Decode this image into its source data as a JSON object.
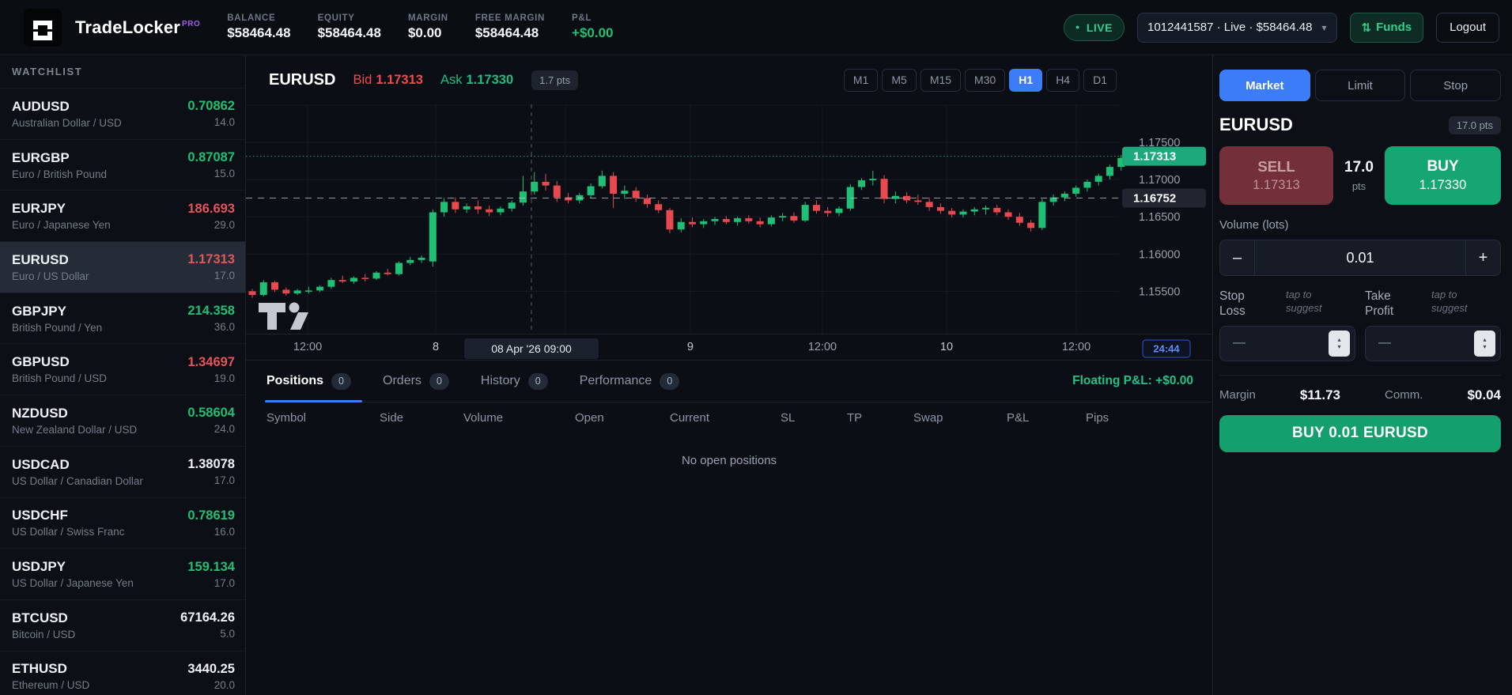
{
  "colors": {
    "up": "#1fbf75",
    "down": "#e8494f",
    "watch_down": "#e4555a",
    "up_badge": "#1ea97c",
    "accent_blue": "#3d7cf7",
    "grid": "#161b24",
    "axis_text": "#99a1ae",
    "major_text": "#c2c9d4",
    "dashed_line": "#cfd4dc",
    "tooltip_bg": "#1c212e",
    "countdown_text": "#5d8dff",
    "countdown_border": "#2d55cc"
  },
  "icons": {
    "live_dot": "●",
    "funds_icon": "⇅",
    "dropdown_chevron": "▾",
    "spinner_up": "▴",
    "spinner_down": "▾"
  },
  "topbar": {
    "brand": "TradeLocker",
    "brand_badge": "PRO",
    "stats": [
      {
        "label": "BALANCE",
        "value": "$58464.48",
        "accent": false
      },
      {
        "label": "EQUITY",
        "value": "$58464.48",
        "accent": false
      },
      {
        "label": "MARGIN",
        "value": "$0.00",
        "accent": false
      },
      {
        "label": "FREE MARGIN",
        "value": "$58464.48",
        "accent": false
      },
      {
        "label": "P&L",
        "value": "+$0.00",
        "accent": true
      }
    ],
    "live_badge": "LIVE",
    "account_selector": "1012441587 · Live · $58464.48",
    "funds_label": "Funds",
    "logout_label": "Logout"
  },
  "watchlist": {
    "title": "WATCHLIST",
    "items": [
      {
        "symbol": "AUDUSD",
        "name": "Australian Dollar / USD",
        "price": "0.70862",
        "spread": "14.0",
        "dir": "up",
        "selected": false
      },
      {
        "symbol": "EURGBP",
        "name": "Euro / British Pound",
        "price": "0.87087",
        "spread": "15.0",
        "dir": "up",
        "selected": false
      },
      {
        "symbol": "EURJPY",
        "name": "Euro / Japanese Yen",
        "price": "186.693",
        "spread": "29.0",
        "dir": "down",
        "selected": false
      },
      {
        "symbol": "EURUSD",
        "name": "Euro / US Dollar",
        "price": "1.17313",
        "spread": "17.0",
        "dir": "down",
        "selected": true
      },
      {
        "symbol": "GBPJPY",
        "name": "British Pound / Yen",
        "price": "214.358",
        "spread": "36.0",
        "dir": "up",
        "selected": false
      },
      {
        "symbol": "GBPUSD",
        "name": "British Pound / USD",
        "price": "1.34697",
        "spread": "19.0",
        "dir": "down",
        "selected": false
      },
      {
        "symbol": "NZDUSD",
        "name": "New Zealand Dollar / USD",
        "price": "0.58604",
        "spread": "24.0",
        "dir": "up",
        "selected": false
      },
      {
        "symbol": "USDCAD",
        "name": "US Dollar / Canadian Dollar",
        "price": "1.38078",
        "spread": "17.0",
        "dir": "flat",
        "selected": false
      },
      {
        "symbol": "USDCHF",
        "name": "US Dollar / Swiss Franc",
        "price": "0.78619",
        "spread": "16.0",
        "dir": "up",
        "selected": false
      },
      {
        "symbol": "USDJPY",
        "name": "US Dollar / Japanese Yen",
        "price": "159.134",
        "spread": "17.0",
        "dir": "up",
        "selected": false
      },
      {
        "symbol": "BTCUSD",
        "name": "Bitcoin / USD",
        "price": "67164.26",
        "spread": "5.0",
        "dir": "flat",
        "selected": false
      },
      {
        "symbol": "ETHUSD",
        "name": "Ethereum / USD",
        "price": "3440.25",
        "spread": "20.0",
        "dir": "flat",
        "selected": false
      }
    ]
  },
  "chart": {
    "symbol": "EURUSD",
    "bid_label": "Bid",
    "bid": "1.17313",
    "ask_label": "Ask",
    "ask": "1.17330",
    "spread_badge": "1.7 pts",
    "timeframes": [
      "M1",
      "M5",
      "M15",
      "M30",
      "H1",
      "H4",
      "D1"
    ],
    "active_timeframe": "H1"
  },
  "chart_data": {
    "type": "candlestick",
    "symbol": "EURUSD",
    "timeframe": "H1",
    "y_axis": {
      "range": [
        1.1493,
        1.1801
      ],
      "ticks": [
        {
          "v": 1.175,
          "label": "1.17500"
        },
        {
          "v": 1.17,
          "label": "1.17000"
        },
        {
          "v": 1.165,
          "label": "1.16500"
        },
        {
          "v": 1.16,
          "label": "1.16000"
        },
        {
          "v": 1.155,
          "label": "1.15500"
        }
      ],
      "gridlines": [
        1.18,
        1.175,
        1.17,
        1.165,
        1.16,
        1.155
      ]
    },
    "x_axis": {
      "ticks": [
        {
          "label": "12:00",
          "f": 0.0707,
          "major": false
        },
        {
          "label": "8",
          "f": 0.2174,
          "major": true
        },
        {
          "label": "9",
          "f": 0.509,
          "major": true
        },
        {
          "label": "12:00",
          "f": 0.6603,
          "major": false
        },
        {
          "label": "10",
          "f": 0.8025,
          "major": true
        },
        {
          "label": "12:00",
          "f": 0.9511,
          "major": false
        }
      ],
      "gridlines": [
        0.0707,
        0.2174,
        0.3659,
        0.509,
        0.6603,
        0.8025,
        0.9511
      ]
    },
    "price_lines": [
      {
        "v": 1.17313,
        "label": "1.17313",
        "style": "dotted",
        "kind": "last-price"
      },
      {
        "v": 1.16752,
        "label": "1.16752",
        "style": "dashed",
        "kind": "level"
      }
    ],
    "crosshair": {
      "f": 0.327,
      "time_label": "08 Apr '26  09:00"
    },
    "countdown": "24:44",
    "candles": [
      [
        1.155,
        1.1553,
        1.1541,
        1.1545
      ],
      [
        1.1545,
        1.1565,
        1.1543,
        1.1562
      ],
      [
        1.1562,
        1.1564,
        1.1549,
        1.1552
      ],
      [
        1.1552,
        1.1555,
        1.1544,
        1.1547
      ],
      [
        1.1547,
        1.1553,
        1.1545,
        1.1551
      ],
      [
        1.1551,
        1.1556,
        1.1547,
        1.1551
      ],
      [
        1.1551,
        1.1558,
        1.1549,
        1.1556
      ],
      [
        1.1556,
        1.1568,
        1.1553,
        1.1565
      ],
      [
        1.1565,
        1.1571,
        1.1561,
        1.1563
      ],
      [
        1.1563,
        1.157,
        1.156,
        1.1568
      ],
      [
        1.1568,
        1.1573,
        1.1563,
        1.1567
      ],
      [
        1.1567,
        1.1577,
        1.1565,
        1.1575
      ],
      [
        1.1575,
        1.158,
        1.1571,
        1.1573
      ],
      [
        1.1573,
        1.159,
        1.1571,
        1.1588
      ],
      [
        1.1588,
        1.1596,
        1.1585,
        1.1592
      ],
      [
        1.1592,
        1.1598,
        1.1588,
        1.1595
      ],
      [
        1.159,
        1.166,
        1.1583,
        1.1656
      ],
      [
        1.1656,
        1.1675,
        1.165,
        1.167
      ],
      [
        1.167,
        1.1676,
        1.1655,
        1.166
      ],
      [
        1.166,
        1.1668,
        1.1655,
        1.1664
      ],
      [
        1.1664,
        1.1672,
        1.1654,
        1.166
      ],
      [
        1.166,
        1.1665,
        1.1651,
        1.1656
      ],
      [
        1.1656,
        1.1664,
        1.1652,
        1.1661
      ],
      [
        1.1661,
        1.1672,
        1.1657,
        1.1669
      ],
      [
        1.1669,
        1.1705,
        1.1665,
        1.1684
      ],
      [
        1.1684,
        1.171,
        1.168,
        1.1697
      ],
      [
        1.1697,
        1.1708,
        1.1685,
        1.1692
      ],
      [
        1.1692,
        1.1698,
        1.167,
        1.1676
      ],
      [
        1.1676,
        1.1682,
        1.1668,
        1.1672
      ],
      [
        1.1672,
        1.1682,
        1.1668,
        1.1679
      ],
      [
        1.1679,
        1.1695,
        1.1675,
        1.1691
      ],
      [
        1.1691,
        1.1712,
        1.1688,
        1.1705
      ],
      [
        1.1705,
        1.171,
        1.1662,
        1.1681
      ],
      [
        1.1681,
        1.1692,
        1.1674,
        1.1685
      ],
      [
        1.1685,
        1.169,
        1.167,
        1.1675
      ],
      [
        1.1675,
        1.168,
        1.1662,
        1.1667
      ],
      [
        1.1667,
        1.1672,
        1.1655,
        1.1659
      ],
      [
        1.1659,
        1.1662,
        1.1628,
        1.1633
      ],
      [
        1.1633,
        1.1648,
        1.1629,
        1.1643
      ],
      [
        1.1643,
        1.1649,
        1.1636,
        1.164
      ],
      [
        1.164,
        1.1647,
        1.1635,
        1.1644
      ],
      [
        1.1644,
        1.165,
        1.1639,
        1.1647
      ],
      [
        1.1647,
        1.1651,
        1.164,
        1.1643
      ],
      [
        1.1643,
        1.165,
        1.1638,
        1.1648
      ],
      [
        1.1648,
        1.1652,
        1.1641,
        1.1644
      ],
      [
        1.1644,
        1.1649,
        1.1636,
        1.164
      ],
      [
        1.164,
        1.1652,
        1.1637,
        1.1649
      ],
      [
        1.1649,
        1.1655,
        1.1644,
        1.1651
      ],
      [
        1.1651,
        1.1656,
        1.1642,
        1.1645
      ],
      [
        1.1645,
        1.167,
        1.1643,
        1.1666
      ],
      [
        1.1666,
        1.1672,
        1.1654,
        1.1658
      ],
      [
        1.1658,
        1.1663,
        1.165,
        1.1655
      ],
      [
        1.1655,
        1.1664,
        1.1651,
        1.1661
      ],
      [
        1.1661,
        1.1694,
        1.1658,
        1.169
      ],
      [
        1.169,
        1.1702,
        1.1686,
        1.1699
      ],
      [
        1.1699,
        1.1712,
        1.1692,
        1.1701
      ],
      [
        1.1701,
        1.1706,
        1.1668,
        1.1674
      ],
      [
        1.1674,
        1.1684,
        1.1668,
        1.1678
      ],
      [
        1.1678,
        1.1683,
        1.1668,
        1.1672
      ],
      [
        1.1672,
        1.168,
        1.1666,
        1.167
      ],
      [
        1.167,
        1.1676,
        1.1658,
        1.1663
      ],
      [
        1.1663,
        1.1668,
        1.1654,
        1.1658
      ],
      [
        1.1658,
        1.1662,
        1.1649,
        1.1653
      ],
      [
        1.1653,
        1.166,
        1.1649,
        1.1657
      ],
      [
        1.1657,
        1.1663,
        1.1652,
        1.166
      ],
      [
        1.166,
        1.1665,
        1.1653,
        1.1662
      ],
      [
        1.1662,
        1.1666,
        1.1652,
        1.1656
      ],
      [
        1.1656,
        1.166,
        1.1646,
        1.165
      ],
      [
        1.165,
        1.1655,
        1.1638,
        1.1642
      ],
      [
        1.1642,
        1.1646,
        1.163,
        1.1635
      ],
      [
        1.1635,
        1.1674,
        1.1632,
        1.167
      ],
      [
        1.167,
        1.168,
        1.1665,
        1.1676
      ],
      [
        1.1676,
        1.1684,
        1.1671,
        1.1681
      ],
      [
        1.1681,
        1.1692,
        1.1677,
        1.1689
      ],
      [
        1.1689,
        1.17,
        1.1684,
        1.1697
      ],
      [
        1.1697,
        1.1708,
        1.1692,
        1.1705
      ],
      [
        1.1705,
        1.172,
        1.17,
        1.1717
      ],
      [
        1.1717,
        1.1733,
        1.1712,
        1.1729
      ],
      [
        1.1729,
        1.1736,
        1.1722,
        1.17313
      ]
    ]
  },
  "positions_panel": {
    "tabs": [
      {
        "label": "Positions",
        "count": "0",
        "active": true
      },
      {
        "label": "Orders",
        "count": "0",
        "active": false
      },
      {
        "label": "History",
        "count": "0",
        "active": false
      },
      {
        "label": "Performance",
        "count": "0",
        "active": false
      }
    ],
    "floating_pnl": "Floating P&L: +$0.00",
    "columns": [
      "Symbol",
      "Side",
      "Volume",
      "Open",
      "Current",
      "SL",
      "TP",
      "Swap",
      "P&L",
      "Pips"
    ],
    "empty_message": "No open positions"
  },
  "order_panel": {
    "tabs": [
      "Market",
      "Limit",
      "Stop"
    ],
    "active_tab": "Market",
    "symbol": "EURUSD",
    "spread_badge": "17.0 pts",
    "sell": {
      "label": "SELL",
      "price": "1.17313"
    },
    "buy": {
      "label": "BUY",
      "price": "1.17330"
    },
    "spread_value": "17.0",
    "spread_unit": "pts",
    "volume_label": "Volume (lots)",
    "volume_value": "0.01",
    "minus_label": "–",
    "plus_label": "+",
    "stop_loss": {
      "label": "Stop Loss",
      "hint": "tap to suggest",
      "placeholder": "—"
    },
    "take_profit": {
      "label": "Take Profit",
      "hint": "tap to suggest",
      "placeholder": "—"
    },
    "margin_label": "Margin",
    "margin_value": "$11.73",
    "comm_label": "Comm.",
    "comm_value": "$0.04",
    "submit_label": "BUY 0.01 EURUSD"
  }
}
